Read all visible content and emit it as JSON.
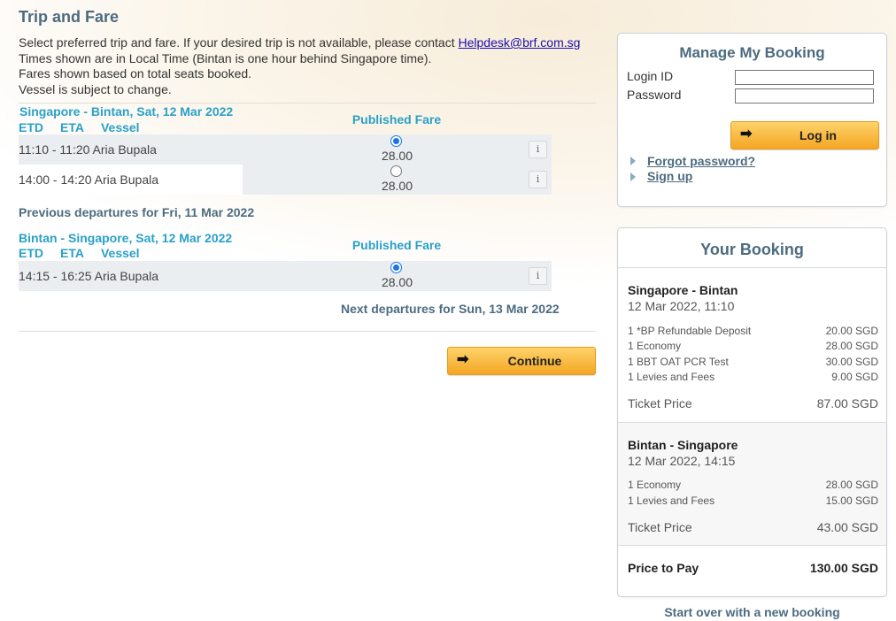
{
  "page": {
    "title": "Trip and Fare",
    "intro_line1": "Select preferred trip and fare. If your desired trip is not available, please contact ",
    "helpdesk_link": "Helpdesk@brf.com.sg",
    "intro_line2": "Times shown are in Local Time (Bintan is one hour behind Singapore time).",
    "intro_line3": "Fares shown based on total seats booked.",
    "intro_line4": "Vessel is subject to change."
  },
  "outbound": {
    "route_header": "Singapore - Bintan, Sat, 12 Mar 2022",
    "col_etd": "ETD",
    "col_eta": "ETA",
    "col_vessel": "Vessel",
    "fare_header": "Published Fare",
    "trips": [
      {
        "label": "11:10 - 11:20 Aria Bupala",
        "fare": "28.00",
        "selected": true
      },
      {
        "label": "14:00 - 14:20 Aria Bupala",
        "fare": "28.00",
        "selected": false
      }
    ],
    "previous_link": "Previous departures for Fri, 11 Mar 2022"
  },
  "return": {
    "route_header": "Bintan - Singapore, Sat, 12 Mar 2022",
    "col_etd": "ETD",
    "col_eta": "ETA",
    "col_vessel": "Vessel",
    "fare_header": "Published Fare",
    "trips": [
      {
        "label": "14:15 - 16:25 Aria Bupala",
        "fare": "28.00",
        "selected": true
      }
    ],
    "next_link": "Next departures for Sun, 13 Mar 2022"
  },
  "continue_label": "Continue",
  "icons": {
    "info": "i",
    "arrow": "➡"
  },
  "manage_booking": {
    "title": "Manage My Booking",
    "login_label": "Login ID",
    "password_label": "Password",
    "login_value": "",
    "password_value": "",
    "login_button": "Log in",
    "forgot_link": "Forgot password?",
    "signup_link": "Sign up"
  },
  "your_booking": {
    "title": "Your Booking",
    "legs": [
      {
        "route": "Singapore - Bintan",
        "datetime": "12 Mar 2022, 11:10",
        "items": [
          {
            "desc": "1 *BP Refundable Deposit",
            "amount": "20.00 SGD"
          },
          {
            "desc": "1 Economy",
            "amount": "28.00 SGD"
          },
          {
            "desc": "1 BBT OAT PCR Test",
            "amount": "30.00 SGD"
          },
          {
            "desc": "1 Levies and Fees",
            "amount": "9.00 SGD"
          }
        ],
        "ticket_label": "Ticket Price",
        "ticket_price": "87.00 SGD"
      },
      {
        "route": "Bintan - Singapore",
        "datetime": "12 Mar 2022, 14:15",
        "items": [
          {
            "desc": "1 Economy",
            "amount": "28.00 SGD"
          },
          {
            "desc": "1 Levies and Fees",
            "amount": "15.00 SGD"
          }
        ],
        "ticket_label": "Ticket Price",
        "ticket_price": "43.00 SGD"
      }
    ],
    "price_to_pay_label": "Price to Pay",
    "price_to_pay": "130.00 SGD"
  },
  "start_over_link": "Start over with a new booking",
  "colors": {
    "accent": "#2aa0c8",
    "heading": "#4d6b80",
    "button": "#f5a623",
    "radio": "#1a73e8"
  }
}
